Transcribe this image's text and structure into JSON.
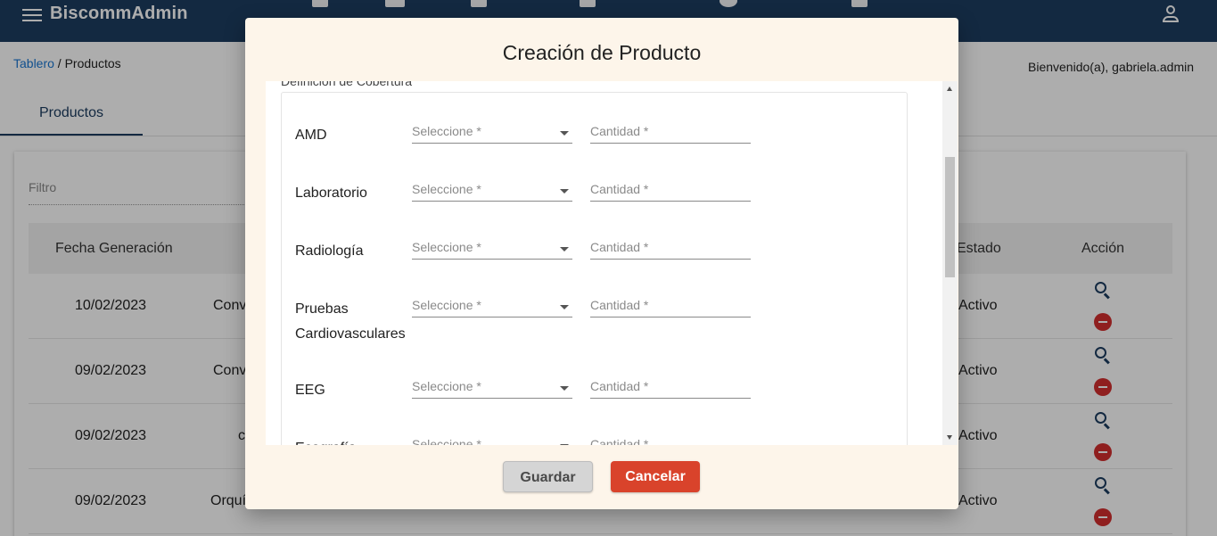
{
  "app": {
    "brand": "BiscommAdmin",
    "welcome": "Bienvenido(a), gabriela.admin"
  },
  "breadcrumb": {
    "home": "Tablero",
    "separator": " / ",
    "current": "Productos"
  },
  "tabs": {
    "active": "Productos"
  },
  "filter": {
    "placeholder": "Filtro"
  },
  "table": {
    "headers": {
      "date": "Fecha Generación",
      "status": "Estado",
      "action": "Acción"
    },
    "rows": [
      {
        "date": "10/02/2023",
        "name_partial": "Conv",
        "status": "Activo"
      },
      {
        "date": "09/02/2023",
        "name_partial": "Conv",
        "status": "Activo"
      },
      {
        "date": "09/02/2023",
        "name_partial": "c",
        "status": "Activo"
      },
      {
        "date": "09/02/2023",
        "name_partial": "Orquí",
        "status": "Activo"
      }
    ]
  },
  "modal": {
    "title": "Creación de Producto",
    "section_legend": "Definición de Cobertura",
    "coverage": [
      {
        "label": "AMD",
        "select": "Seleccione *",
        "qty": "Cantidad *"
      },
      {
        "label": "Laboratorio",
        "select": "Seleccione *",
        "qty": "Cantidad *"
      },
      {
        "label": "Radiología",
        "select": "Seleccione *",
        "qty": "Cantidad *"
      },
      {
        "label": "Pruebas Cardiovasculares",
        "select": "Seleccione *",
        "qty": "Cantidad *"
      },
      {
        "label": "EEG",
        "select": "Seleccione *",
        "qty": "Cantidad *"
      },
      {
        "label": "Ecografía",
        "select": "Seleccione *",
        "qty": "Cantidad *"
      }
    ],
    "save_label": "Guardar",
    "cancel_label": "Cancelar"
  },
  "colors": {
    "topbar": "#1c3d61",
    "modal_bg": "#fdf5ea",
    "cancel_button": "#d9432b",
    "remove_icon": "#d32f2f"
  }
}
